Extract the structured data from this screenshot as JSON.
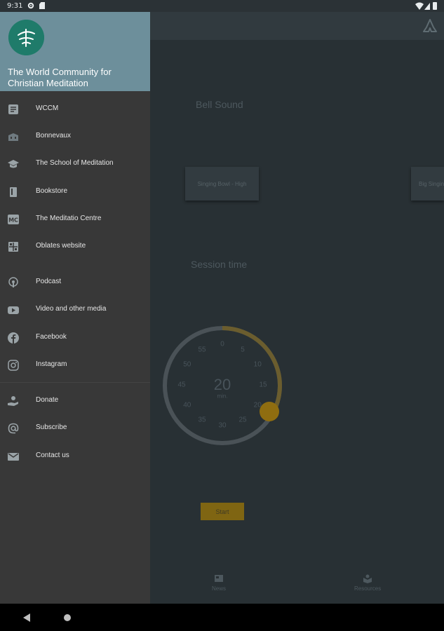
{
  "status_bar": {
    "time": "9:31"
  },
  "drawer": {
    "title": "The World Community for Christian Meditation",
    "items": [
      {
        "label": "WCCM",
        "icon": "wccm-logo-icon"
      },
      {
        "label": "Bonnevaux",
        "icon": "building-icon"
      },
      {
        "label": "The School of Meditation",
        "icon": "graduation-cap-icon"
      },
      {
        "label": "Bookstore",
        "icon": "book-icon"
      },
      {
        "label": "The Meditatio Centre",
        "icon": "mc-badge-icon"
      },
      {
        "label": "Oblates website",
        "icon": "window-grid-icon"
      },
      {
        "label": "Podcast",
        "icon": "podcast-icon"
      },
      {
        "label": "Video and other media",
        "icon": "youtube-icon"
      },
      {
        "label": "Facebook",
        "icon": "facebook-icon"
      },
      {
        "label": "Instagram",
        "icon": "instagram-icon"
      },
      {
        "label": "Donate",
        "icon": "donate-hand-icon"
      },
      {
        "label": "Subscribe",
        "icon": "at-sign-icon"
      },
      {
        "label": "Contact us",
        "icon": "mail-icon"
      }
    ]
  },
  "main": {
    "bell_sound_label": "Bell Sound",
    "sounds": [
      {
        "label": "Singing Bowl - High"
      },
      {
        "label": "Big Singing Bowl"
      }
    ],
    "session_time_label": "Session time",
    "dial": {
      "value": "20",
      "unit": "min.",
      "selected_minutes": 20,
      "max_minutes": 60,
      "ticks": [
        "0",
        "5",
        "10",
        "15",
        "20",
        "25",
        "30",
        "35",
        "40",
        "45",
        "50",
        "55"
      ]
    },
    "start_label": "Start"
  },
  "bottom_nav": {
    "news_label": "News",
    "resources_label": "Resources"
  },
  "colors": {
    "drawer_header": "#6d8f9b",
    "drawer_bg": "#383838",
    "accent_gold": "#8f6d10",
    "logo_green": "#1f7b6a"
  }
}
